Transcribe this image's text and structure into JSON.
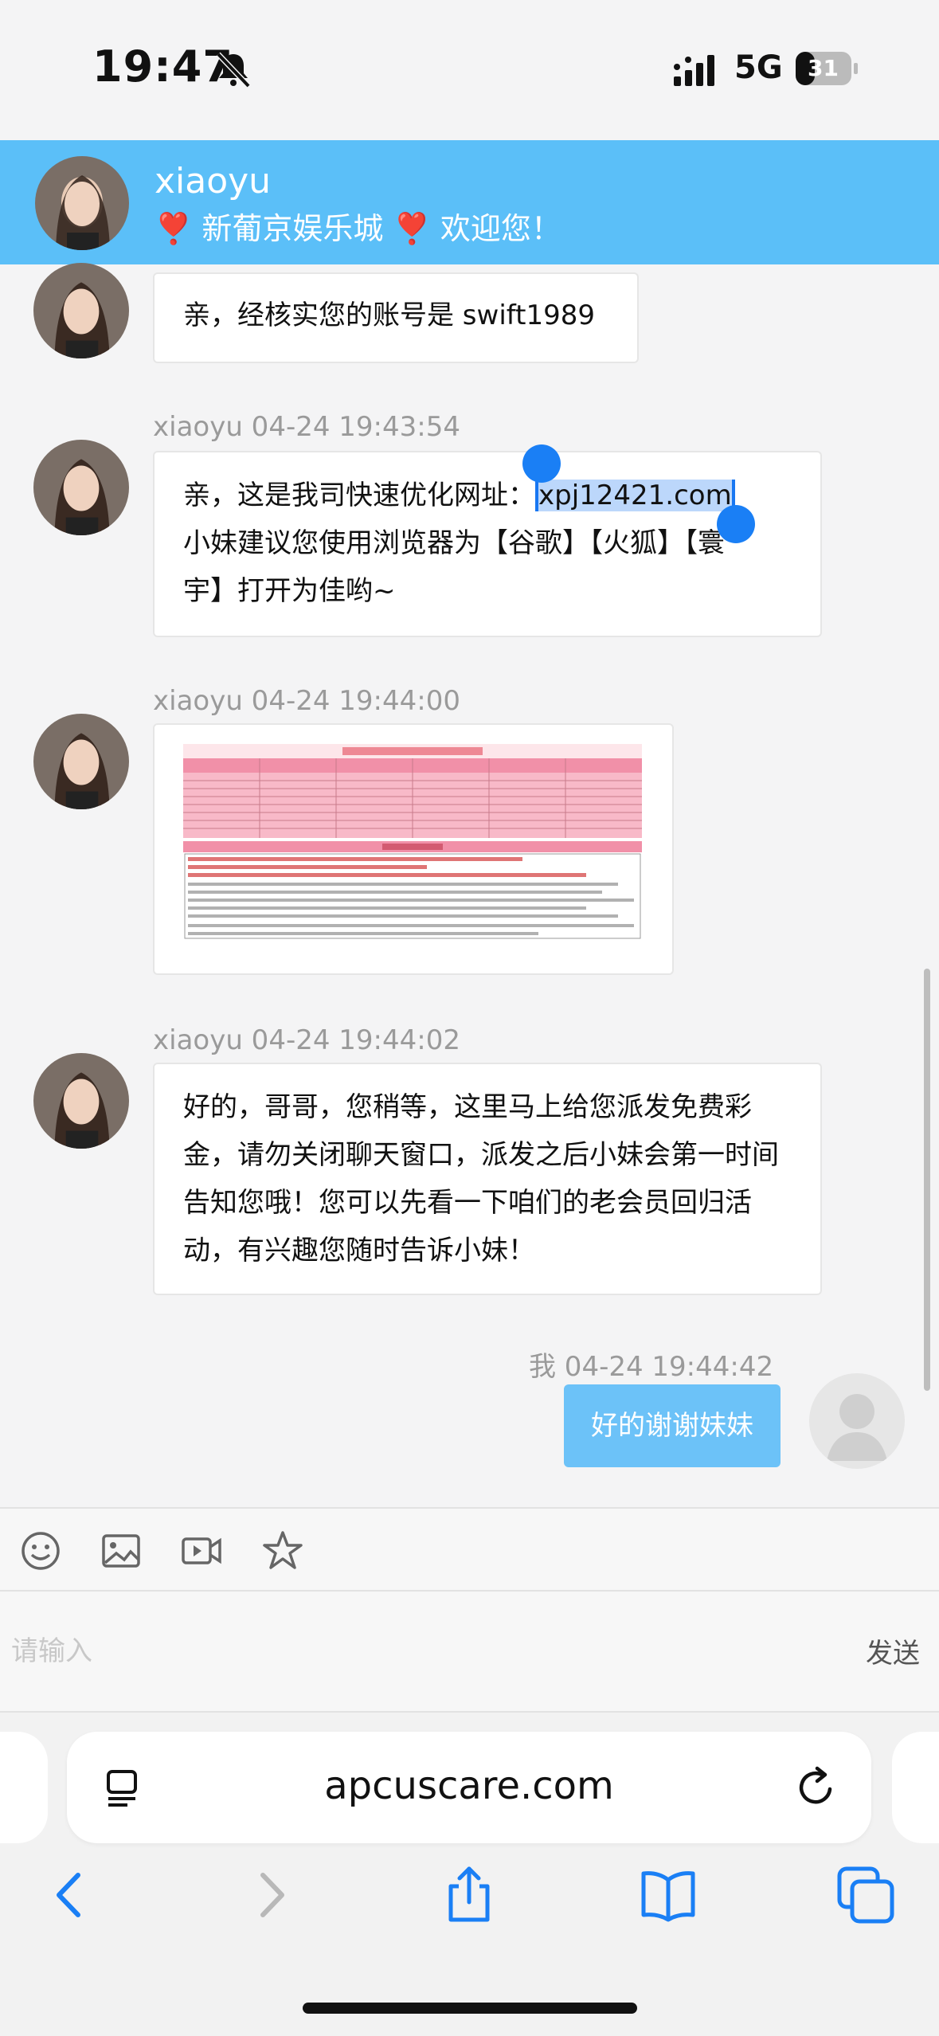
{
  "status_bar": {
    "time": "19:47",
    "network": "5G",
    "battery": "31"
  },
  "header": {
    "name": "xiaoyu",
    "welcome": "❣️ 新葡京娱乐城 ❣️ 欢迎您！"
  },
  "messages": [
    {
      "text": "亲，经核实您的账号是 swift1989"
    },
    {
      "meta": "xiaoyu  04-24 19:43:54",
      "line1_prefix": "亲，这是我司快速优化网址：",
      "line1_link": "xpj12421.com",
      "line2": "小妹建议您使用浏览器为【谷歌】【火狐】【寰",
      "line3": "宇】打开为佳哟~"
    },
    {
      "meta": "xiaoyu  04-24 19:44:00"
    },
    {
      "meta": "xiaoyu  04-24 19:44:02",
      "lines": [
        "好的，哥哥，您稍等，这里马上给您派发免费彩",
        "金，请勿关闭聊天窗口，派发之后小妹会第一时间",
        "告知您哦！您可以先看一下咱们的老会员回归活",
        "动，有兴趣您随时告诉小妹！"
      ]
    }
  ],
  "self_message": {
    "meta": "我 04-24 19:44:42",
    "text": "好的谢谢妹妹"
  },
  "input": {
    "placeholder": "请输入",
    "send_label": "发送"
  },
  "safari": {
    "url": "apcuscare.com"
  },
  "icons": {
    "toolbar": [
      "emoji-icon",
      "image-icon",
      "video-icon",
      "star-icon"
    ],
    "nav": [
      "back-icon",
      "forward-icon",
      "share-icon",
      "bookmarks-icon",
      "tabs-icon"
    ]
  },
  "colors": {
    "header": "#5bbff8",
    "self_bubble": "#6cc2f8",
    "selection": "#1a7ff5",
    "ios_blue": "#1a7ff5"
  }
}
